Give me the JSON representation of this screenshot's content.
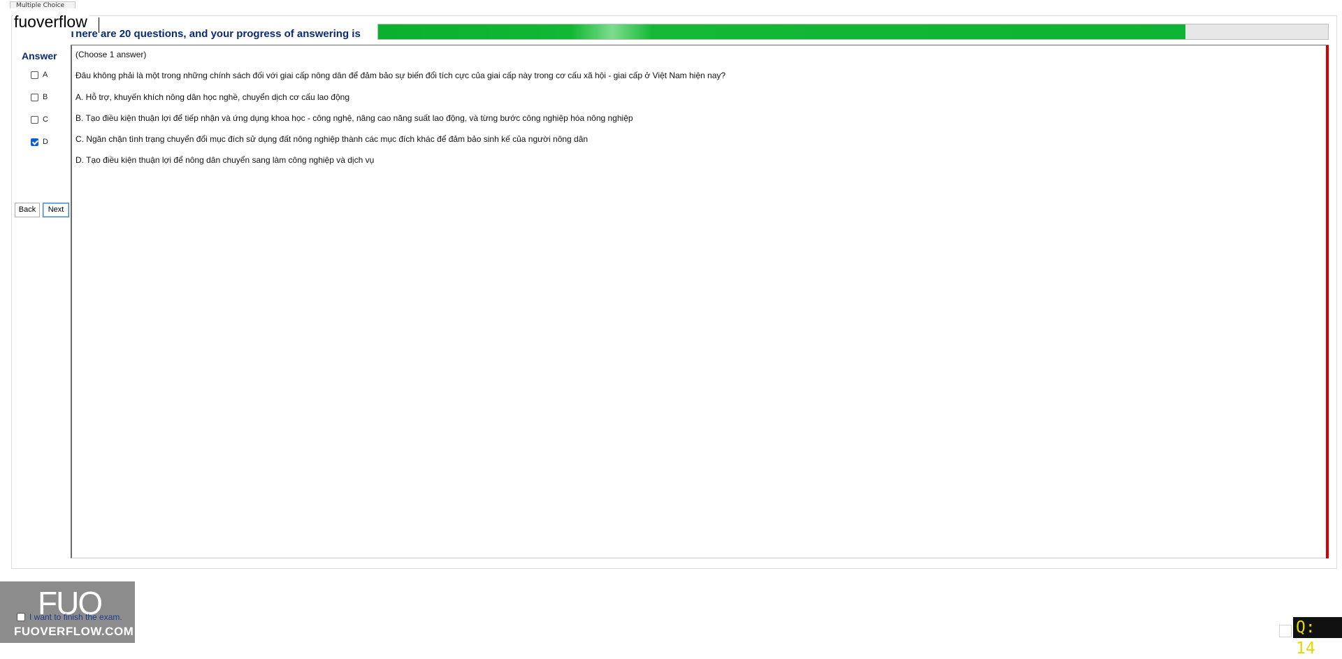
{
  "window": {
    "tab_label": "Multiple Choice"
  },
  "brand": {
    "text": "fuoverflow"
  },
  "header": {
    "text": "There are 20 questions, and your progress of answering is",
    "progress_fraction": 0.85,
    "progress_color": "#0db332"
  },
  "answer_panel": {
    "title": "Answer",
    "options": [
      {
        "label": "A",
        "checked": false
      },
      {
        "label": "B",
        "checked": false
      },
      {
        "label": "C",
        "checked": false
      },
      {
        "label": "D",
        "checked": true
      }
    ],
    "back_label": "Back",
    "next_label": "Next"
  },
  "question": {
    "instruction": "(Choose 1 answer)",
    "text": "Đâu không phải là một trong những chính sách đối với giai cấp nông dân để đảm bảo sự biến đổi tích cực của giai cấp này trong cơ cấu xã hội - giai cấp ở Việt Nam hiện nay?",
    "choices": [
      "A.  Hỗ trợ, khuyến khích nông dân học nghề, chuyển dịch cơ cấu lao động",
      "B.  Tạo điều kiện thuận lợi để tiếp nhận và ứng dụng khoa học - công nghệ, nâng cao năng suất lao động, và từng bước công nghiệp hóa nông nghiệp",
      "C.  Ngăn chặn tình trạng chuyển đổi mục đích sử dụng đất nông nghiệp thành các mục đích khác để đảm bảo sinh kế của người nông dân",
      "D.  Tạo điều kiện thuận lợi để nông dân chuyển sang làm công nghiệp và dịch vụ"
    ]
  },
  "footer": {
    "finish_label": "I want to finish the exam.",
    "logo_big": "FUO",
    "logo_small": "FUOVERFLOW.COM",
    "question_counter": "Q: 14"
  },
  "colors": {
    "accent_navy": "#0a2a78",
    "error_bar": "#d40000",
    "checked_blue": "#0a5fd6"
  }
}
